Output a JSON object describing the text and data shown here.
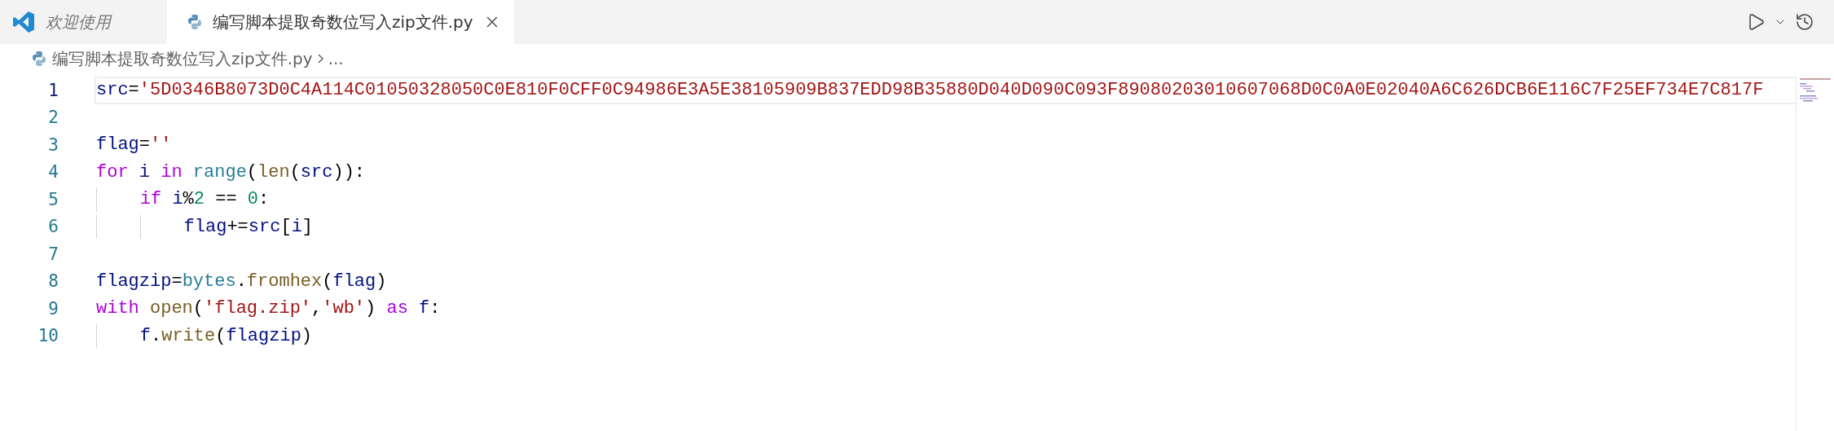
{
  "tabs": [
    {
      "label": "欢迎使用",
      "kind": "welcome",
      "selected": false,
      "preview": true
    },
    {
      "label": "编写脚本提取奇数位写入zip文件.py",
      "kind": "python",
      "selected": true,
      "preview": false
    }
  ],
  "breadcrumb": [
    {
      "label": "编写脚本提取奇数位写入zip文件.py",
      "kind": "python"
    },
    {
      "label": "...",
      "kind": "symbol"
    }
  ],
  "lines": [
    {
      "number": "1",
      "active": true,
      "tokens": [
        {
          "kind": "var",
          "text": "src"
        },
        {
          "kind": "op",
          "text": "="
        },
        {
          "kind": "str",
          "text": "'5D0346B8073D0C4A114C01050328050C0E810F0CFF0C94986E3A5E38105909B837EDD98B35880D040D090C093F89080203010607068D0C0A0E02040A6C626DCB6E116C7F25EF734E7C817F"
        }
      ]
    },
    {
      "number": "2",
      "active": false
    },
    {
      "number": "3",
      "active": false,
      "tokens": [
        {
          "kind": "var",
          "text": "flag"
        },
        {
          "kind": "op",
          "text": "="
        },
        {
          "kind": "str",
          "text": "''"
        }
      ]
    },
    {
      "number": "4",
      "active": false,
      "tokens": [
        {
          "kind": "kw",
          "text": "for "
        },
        {
          "kind": "var",
          "text": "i "
        },
        {
          "kind": "kw",
          "text": "in "
        },
        {
          "kind": "type",
          "text": "range"
        },
        {
          "kind": "op",
          "text": "("
        },
        {
          "kind": "fn",
          "text": "len"
        },
        {
          "kind": "op",
          "text": "("
        },
        {
          "kind": "var",
          "text": "src"
        },
        {
          "kind": "op",
          "text": ")):"
        }
      ],
      "children": [
        {
          "number": "5",
          "active": false,
          "tokens": [
            {
              "kind": "kw",
              "text": "if "
            },
            {
              "kind": "var",
              "text": "i"
            },
            {
              "kind": "op",
              "text": "%"
            },
            {
              "kind": "num",
              "text": "2"
            },
            {
              "kind": "op",
              "text": " == "
            },
            {
              "kind": "num",
              "text": "0"
            },
            {
              "kind": "op",
              "text": ":"
            }
          ],
          "children": [
            {
              "number": "6",
              "active": false,
              "tokens": [
                {
                  "kind": "var",
                  "text": "flag"
                },
                {
                  "kind": "op",
                  "text": "+="
                },
                {
                  "kind": "var",
                  "text": "src"
                },
                {
                  "kind": "op",
                  "text": "["
                },
                {
                  "kind": "var",
                  "text": "i"
                },
                {
                  "kind": "op",
                  "text": "]"
                }
              ]
            }
          ]
        }
      ]
    },
    {
      "number": "7",
      "active": false
    },
    {
      "number": "8",
      "active": false,
      "tokens": [
        {
          "kind": "var",
          "text": "flagzip"
        },
        {
          "kind": "op",
          "text": "="
        },
        {
          "kind": "type",
          "text": "bytes"
        },
        {
          "kind": "op",
          "text": "."
        },
        {
          "kind": "fn",
          "text": "fromhex"
        },
        {
          "kind": "op",
          "text": "("
        },
        {
          "kind": "var",
          "text": "flag"
        },
        {
          "kind": "op",
          "text": ")"
        }
      ]
    },
    {
      "number": "9",
      "active": false,
      "tokens": [
        {
          "kind": "kw",
          "text": "with "
        },
        {
          "kind": "fn",
          "text": "open"
        },
        {
          "kind": "op",
          "text": "("
        },
        {
          "kind": "str",
          "text": "'flag.zip'"
        },
        {
          "kind": "op",
          "text": ","
        },
        {
          "kind": "str",
          "text": "'wb'"
        },
        {
          "kind": "op",
          "text": ") "
        },
        {
          "kind": "kw",
          "text": "as "
        },
        {
          "kind": "var",
          "text": "f"
        },
        {
          "kind": "op",
          "text": ":"
        }
      ],
      "children": [
        {
          "number": "10",
          "active": false,
          "tokens": [
            {
              "kind": "var",
              "text": "f"
            },
            {
              "kind": "op",
              "text": "."
            },
            {
              "kind": "fn",
              "text": "write"
            },
            {
              "kind": "op",
              "text": "("
            },
            {
              "kind": "var",
              "text": "flagzip"
            },
            {
              "kind": "op",
              "text": ")"
            }
          ]
        }
      ]
    }
  ]
}
